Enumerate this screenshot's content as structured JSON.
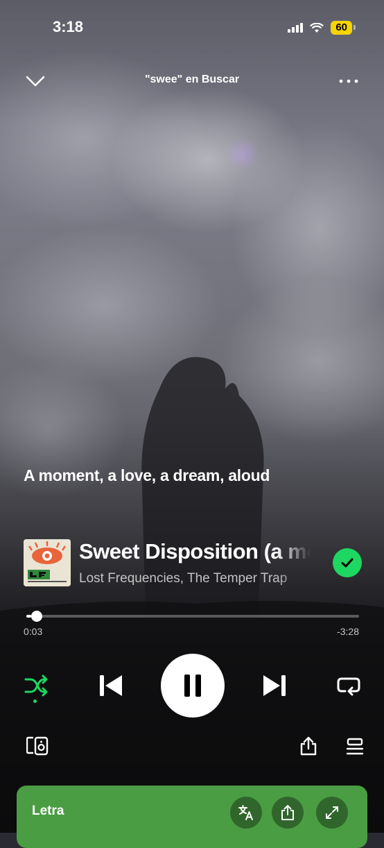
{
  "status_bar": {
    "time": "3:18",
    "battery": "60"
  },
  "header": {
    "title": "\"swee\" en Buscar"
  },
  "lyric_line": "A moment, a love, a dream, aloud",
  "track": {
    "title": "Sweet Disposition (a moment, a love)",
    "artists": "Lost Frequencies, The Temper Trap",
    "liked": true
  },
  "progress": {
    "elapsed": "0:03",
    "remaining": "-3:28",
    "fraction": 0.015
  },
  "controls": {
    "shuffle_active": true,
    "state": "playing"
  },
  "lyrics_card": {
    "label": "Letra"
  },
  "colors": {
    "accent": "#1ed760",
    "lyrics_card": "#4a9d43",
    "battery": "#f5d400"
  }
}
